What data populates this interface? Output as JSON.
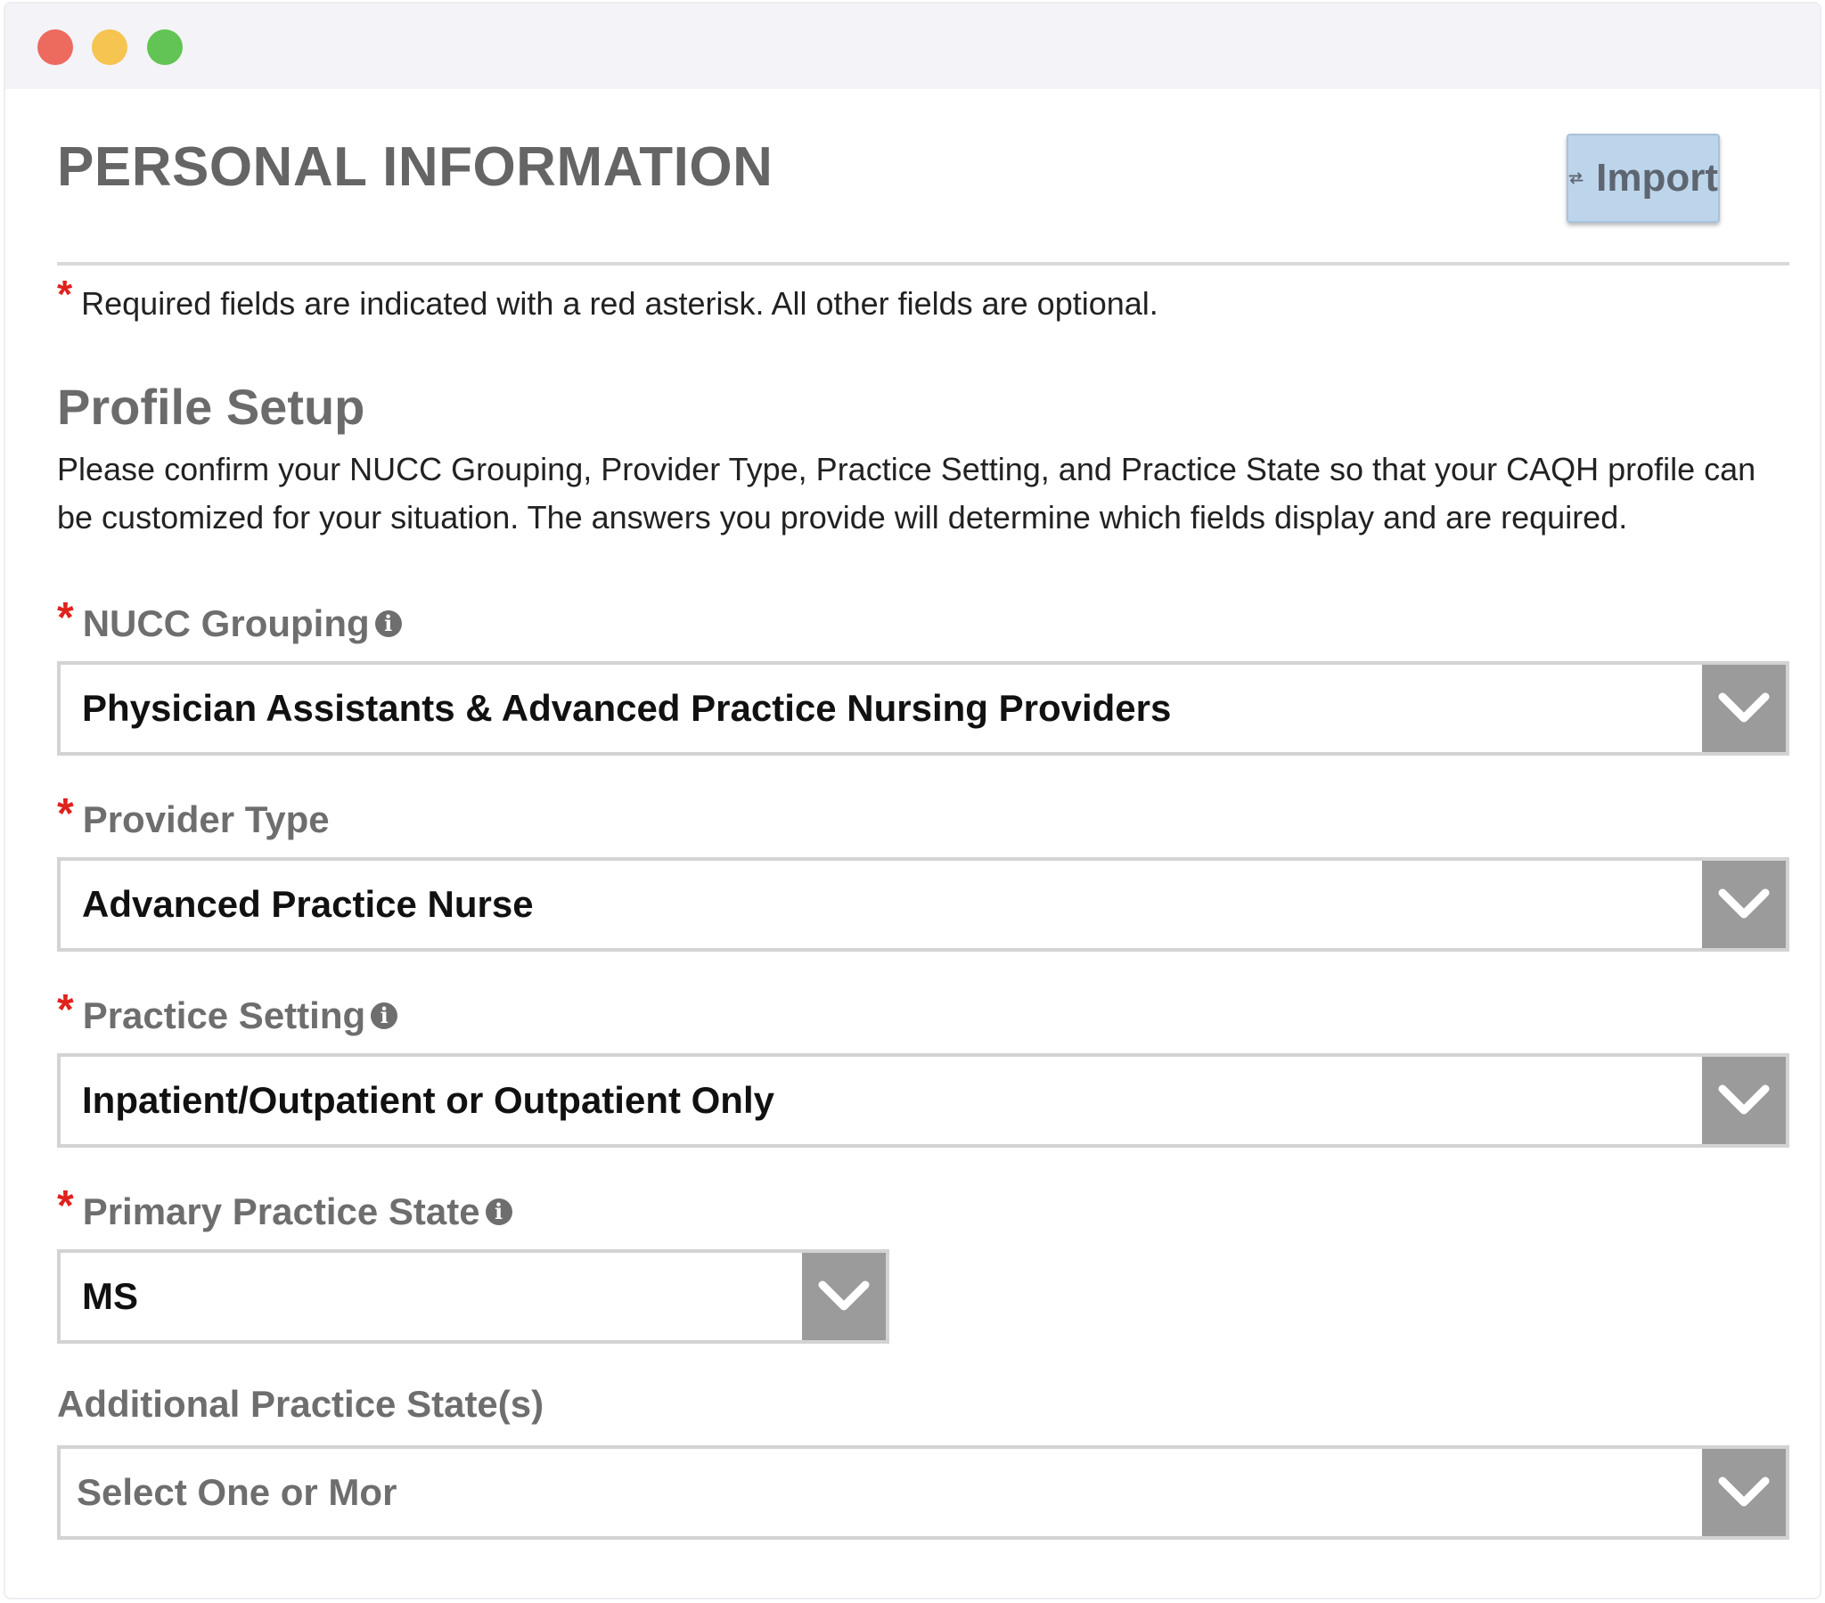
{
  "window": {
    "controls": [
      "close",
      "minimize",
      "maximize"
    ]
  },
  "header": {
    "title": "PERSONAL INFORMATION",
    "import_label": "Import",
    "import_icon": "swap-arrows-icon"
  },
  "required_note": {
    "marker": "*",
    "text": "Required fields are indicated with a red asterisk. All other fields are optional."
  },
  "profile_setup": {
    "title": "Profile Setup",
    "description": "Please confirm your NUCC Grouping, Provider Type, Practice Setting, and Practice State so that your CAQH profile can be customized for your situation. The answers you provide will determine which fields display and are required."
  },
  "fields": {
    "nucc_grouping": {
      "label": "NUCC Grouping",
      "required": true,
      "has_info": true,
      "value": "Physician Assistants & Advanced Practice Nursing Providers"
    },
    "provider_type": {
      "label": "Provider Type",
      "required": true,
      "has_info": false,
      "value": "Advanced Practice Nurse"
    },
    "practice_setting": {
      "label": "Practice Setting",
      "required": true,
      "has_info": true,
      "value": "Inpatient/Outpatient or Outpatient Only"
    },
    "primary_practice_state": {
      "label": "Primary Practice State",
      "required": true,
      "has_info": true,
      "value": "MS"
    },
    "additional_practice_states": {
      "label": "Additional Practice State(s)",
      "required": false,
      "placeholder": "Select One or Mor"
    }
  },
  "colors": {
    "required_star": "#e0221c",
    "import_button_bg": "#bdd5ea",
    "dropdown_arrow_bg": "#9b9b9b",
    "label_gray": "#6e6e6e"
  }
}
